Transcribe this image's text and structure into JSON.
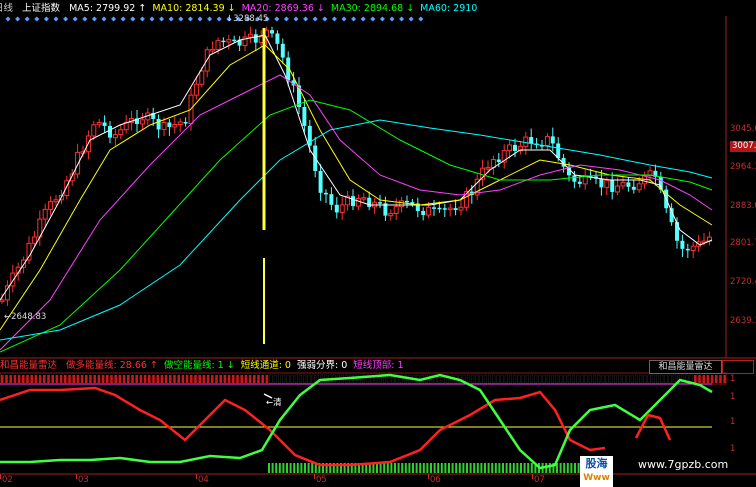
{
  "header": {
    "cut_label": "日线",
    "index_name": "上证指数",
    "ma": [
      {
        "label": "MA5:",
        "value": "2799.92",
        "arrow": "↑",
        "color": "#ffffff"
      },
      {
        "label": "MA10:",
        "value": "2814.39",
        "arrow": "↓",
        "color": "#ffff00"
      },
      {
        "label": "MA20:",
        "value": "2869.36",
        "arrow": "↓",
        "color": "#ff40ff"
      },
      {
        "label": "MA30:",
        "value": "2894.68",
        "arrow": "↓",
        "color": "#00ff00"
      },
      {
        "label": "MA60:",
        "value": "2910",
        "arrow": "",
        "color": "#00ffff"
      }
    ]
  },
  "annotations": {
    "high_label": "3288.45",
    "low_label": "2648.83",
    "signal_label": "清"
  },
  "price_axis": [
    {
      "value": "3045.6",
      "highlight": false
    },
    {
      "value": "3007.2",
      "highlight": true
    },
    {
      "value": "2964.3",
      "highlight": false
    },
    {
      "value": "2883.0",
      "highlight": false
    },
    {
      "value": "2801.7",
      "highlight": false
    },
    {
      "value": "2720.4",
      "highlight": false
    },
    {
      "value": "2639.1",
      "highlight": false
    }
  ],
  "indicator": {
    "title": "和昌能量雷达",
    "items": [
      {
        "label": "做多能量线:",
        "value": "28.66",
        "arrow": "↑",
        "color": "#ff3030"
      },
      {
        "label": "做空能量线:",
        "value": "1",
        "arrow": "↓",
        "color": "#00ff00"
      },
      {
        "label": "短线通道:",
        "value": "0",
        "arrow": "",
        "color": "#ffff00"
      },
      {
        "label": "强弱分界:",
        "value": "0",
        "arrow": "",
        "color": "#ffffff"
      },
      {
        "label": "短线顶部:",
        "value": "1",
        "arrow": "",
        "color": "#ff40ff"
      }
    ],
    "badge": "和昌能量雷达",
    "axis": [
      "1",
      "1",
      "1",
      "1"
    ]
  },
  "date_axis": [
    "02",
    "03",
    "04",
    "05",
    "06",
    "07"
  ],
  "watermark": {
    "logo_top": "股海",
    "logo_bottom": "Www",
    "url": "www.7gpzb.com"
  },
  "colors": {
    "up": "#ff3030",
    "down": "#54ffff",
    "ma5": "#ffffff",
    "ma10": "#ffff00",
    "ma20": "#ff40ff",
    "ma30": "#00ff00",
    "ma60": "#00ffff"
  }
}
